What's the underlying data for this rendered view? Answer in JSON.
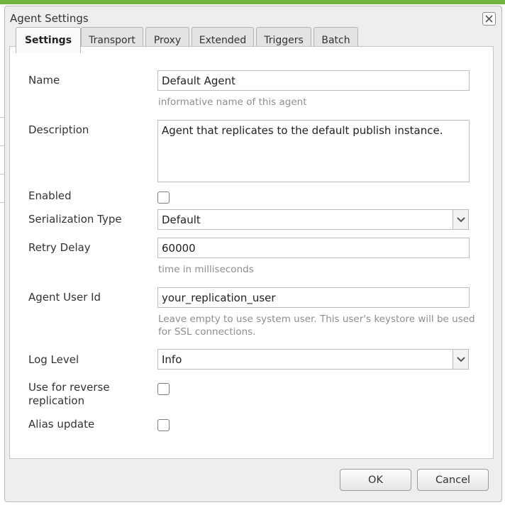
{
  "dialog": {
    "title": "Agent Settings",
    "close_icon": "close-icon"
  },
  "tabs": [
    {
      "label": "Settings",
      "active": true
    },
    {
      "label": "Transport",
      "active": false
    },
    {
      "label": "Proxy",
      "active": false
    },
    {
      "label": "Extended",
      "active": false
    },
    {
      "label": "Triggers",
      "active": false
    },
    {
      "label": "Batch",
      "active": false
    }
  ],
  "form": {
    "name": {
      "label": "Name",
      "value": "Default Agent",
      "hint": "informative name of this agent"
    },
    "description": {
      "label": "Description",
      "value": "Agent that replicates to the default publish instance."
    },
    "enabled": {
      "label": "Enabled",
      "checked": false
    },
    "serialization_type": {
      "label": "Serialization Type",
      "value": "Default"
    },
    "retry_delay": {
      "label": "Retry Delay",
      "value": "60000",
      "hint": "time in milliseconds"
    },
    "agent_user_id": {
      "label": "Agent User Id",
      "value": "your_replication_user",
      "hint_line1": "Leave empty to use system user. This user's keystore will be used",
      "hint_line2": "for SSL connections."
    },
    "log_level": {
      "label": "Log Level",
      "value": "Info"
    },
    "reverse_replication": {
      "label_line1": "Use for reverse",
      "label_line2": "replication",
      "checked": false
    },
    "alias_update": {
      "label": "Alias update",
      "checked": false
    }
  },
  "footer": {
    "ok_label": "OK",
    "cancel_label": "Cancel"
  },
  "colors": {
    "accent_bar": "#6fb33f",
    "dialog_bg": "#eeeeee",
    "hint_text": "#8e8e8e"
  }
}
